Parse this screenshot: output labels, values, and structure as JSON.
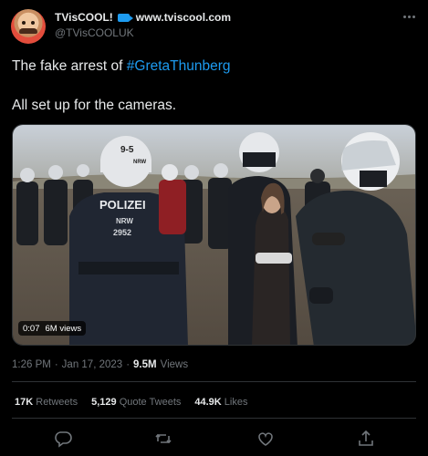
{
  "author": {
    "display_name": "TVisCOOL!",
    "website": "www.tviscool.com",
    "handle": "@TVisCOOLUK"
  },
  "tweet": {
    "text_prefix": "The fake arrest of ",
    "hashtag": "#GretaThunberg",
    "text_line2": "All set up for the cameras."
  },
  "video": {
    "duration": "0:07",
    "views": "6M views",
    "scene_text": {
      "helmet_number": "9-5",
      "helmet_sub": "NRW",
      "vest_label": "POLIZEI",
      "vest_region": "NRW",
      "vest_number": "2952"
    }
  },
  "meta": {
    "time": "1:26 PM",
    "separator": "·",
    "date": "Jan 17, 2023",
    "views_count": "9.5M",
    "views_label": "Views"
  },
  "stats": {
    "retweets_count": "17K",
    "retweets_label": "Retweets",
    "quotes_count": "5,129",
    "quotes_label": "Quote Tweets",
    "likes_count": "44.9K",
    "likes_label": "Likes"
  },
  "icons": {
    "more": "more-dots-icon",
    "reply": "reply-icon",
    "retweet": "retweet-icon",
    "like": "heart-icon",
    "share": "share-icon",
    "verified": "camera-badge-icon"
  },
  "colors": {
    "background": "#000000",
    "text": "#e7e9ea",
    "secondary": "#71767b",
    "accent": "#1d9bf0",
    "divider": "#2f3336"
  }
}
